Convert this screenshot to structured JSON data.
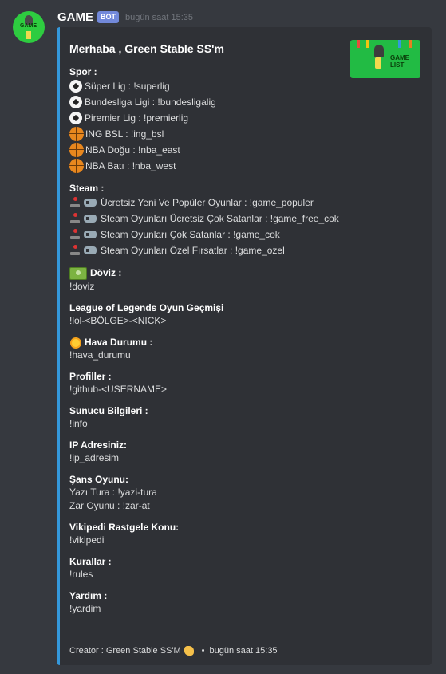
{
  "user": {
    "name": "GAME",
    "badge": "BOT",
    "timestamp": "bugün saat 15:35",
    "avatar_text": "GAME"
  },
  "embed": {
    "accent_color": "#3498db",
    "title": "Merhaba , Green Stable SS'm",
    "thumbnail_text": "GAME\nLIST",
    "sections": {
      "spor": {
        "name": "Spor :",
        "items": [
          {
            "icon": "soccer-ball-icon",
            "text": "Süper Lig : !superlig"
          },
          {
            "icon": "soccer-ball-icon",
            "text": "Bundesliga Ligi : !bundesligalig"
          },
          {
            "icon": "soccer-ball-icon",
            "text": "Piremier Lig : !premierlig"
          },
          {
            "icon": "basketball-icon",
            "text": "ING BSL : !ing_bsl"
          },
          {
            "icon": "basketball-icon",
            "text": "NBA Doğu : !nba_east"
          },
          {
            "icon": "basketball-icon",
            "text": "NBA Batı : !nba_west"
          }
        ]
      },
      "steam": {
        "name": "Steam :",
        "items": [
          {
            "icon": "joystick-icon",
            "text": "Ücretsiz Yeni Ve Popüler Oyunlar : !game_populer"
          },
          {
            "icon": "joystick-icon",
            "text": "Steam Oyunları Ücretsiz Çok Satanlar : !game_free_cok"
          },
          {
            "icon": "joystick-icon",
            "text": "Steam Oyunları Çok Satanlar : !game_cok"
          },
          {
            "icon": "joystick-icon",
            "text": "Steam Oyunları Özel Fırsatlar : !game_ozel"
          }
        ]
      },
      "doviz": {
        "name": "Döviz :",
        "value": "!doviz",
        "icon": "money-icon"
      },
      "lol": {
        "name": "League of Legends Oyun Geçmişi",
        "value": "!lol-<BÖLGE>-<NICK>"
      },
      "hava": {
        "name": "Hava Durumu :",
        "value": "!hava_durumu",
        "icon": "sun-icon"
      },
      "profiller": {
        "name": "Profiller :",
        "value": "!github-<USERNAME>"
      },
      "sunucu": {
        "name": "Sunucu Bilgileri :",
        "value": "!info"
      },
      "ip": {
        "name": "IP Adresiniz:",
        "value": "!ip_adresim"
      },
      "sans": {
        "name": "Şans Oyunu:",
        "lines": [
          "Yazı Tura : !yazi-tura",
          "Zar Oyunu : !zar-at"
        ]
      },
      "vikipedi": {
        "name": "Vikipedi Rastgele Konu:",
        "value": "!vikipedi"
      },
      "kurallar": {
        "name": "Kurallar :",
        "value": "!rules"
      },
      "yardim": {
        "name": "Yardım :",
        "value": "!yardim"
      }
    },
    "footer": {
      "text": "Creator : Green Stable SS'M",
      "icon": "waving-hand-icon",
      "separator": "•",
      "timestamp": "bugün saat 15:35"
    }
  }
}
